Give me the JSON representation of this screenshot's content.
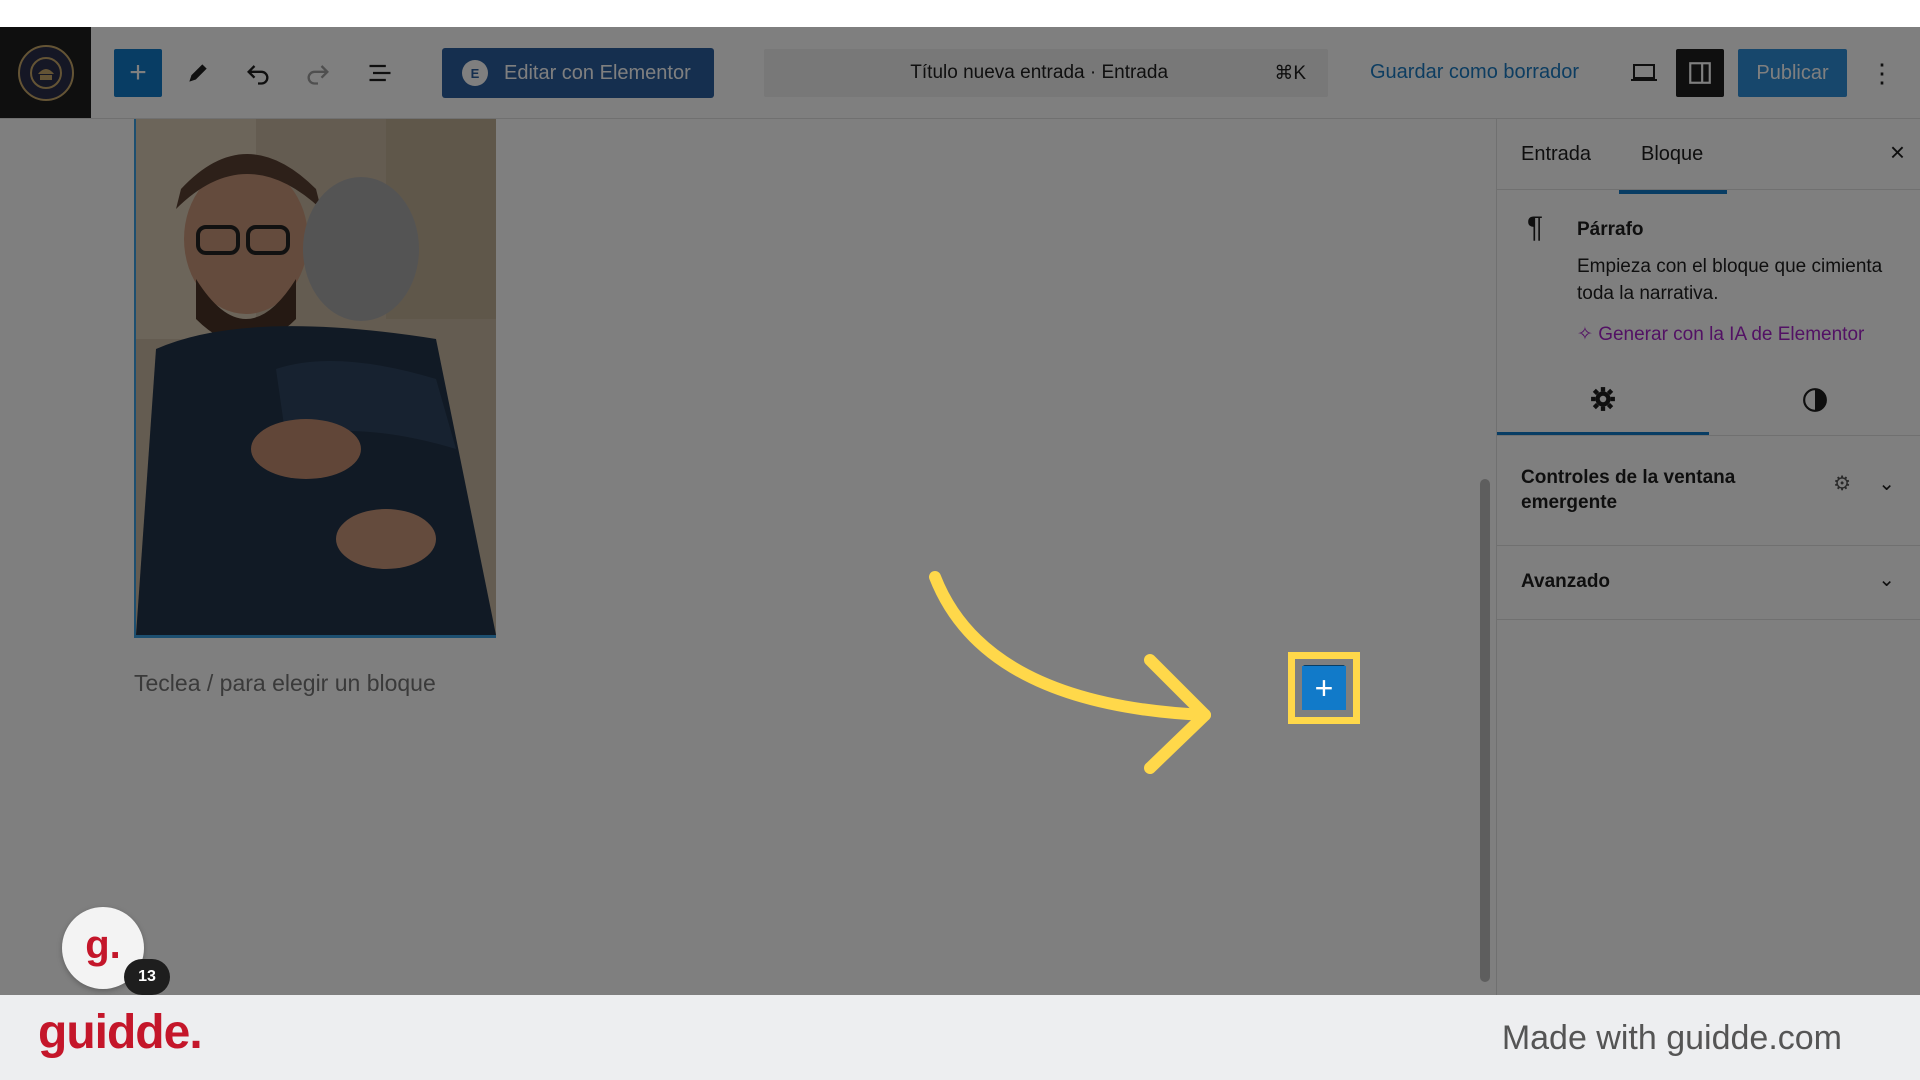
{
  "toolbar": {
    "edit_with_elementor": "Editar con Elementor",
    "command_title": "Título nueva entrada · Entrada",
    "command_shortcut": "⌘K",
    "save_draft": "Guardar como borrador",
    "publish": "Publicar",
    "more": "⋮"
  },
  "canvas": {
    "paragraph_placeholder": "Teclea / para elegir un bloque"
  },
  "sidebar": {
    "tabs": [
      {
        "label": "Entrada"
      },
      {
        "label": "Bloque",
        "active": true
      }
    ],
    "block": {
      "name": "Párrafo",
      "description": "Empieza con el bloque que cimienta toda la narrativa.",
      "ai_link": "Generar con la IA de Elementor"
    },
    "panels": [
      {
        "title": "Controles de la ventana emergente"
      },
      {
        "title": "Avanzado"
      }
    ]
  },
  "overlay": {
    "step_number": "13",
    "highlight_color": "#ffd84a",
    "guidde_letter": "g."
  },
  "footer": {
    "logo": "guidde.",
    "made_with": "Made with guidde.com"
  },
  "colors": {
    "accent": "#117ac9",
    "elementor": "#2a5f9f",
    "ai": "#a523c8",
    "brand_red": "#c4162a"
  }
}
